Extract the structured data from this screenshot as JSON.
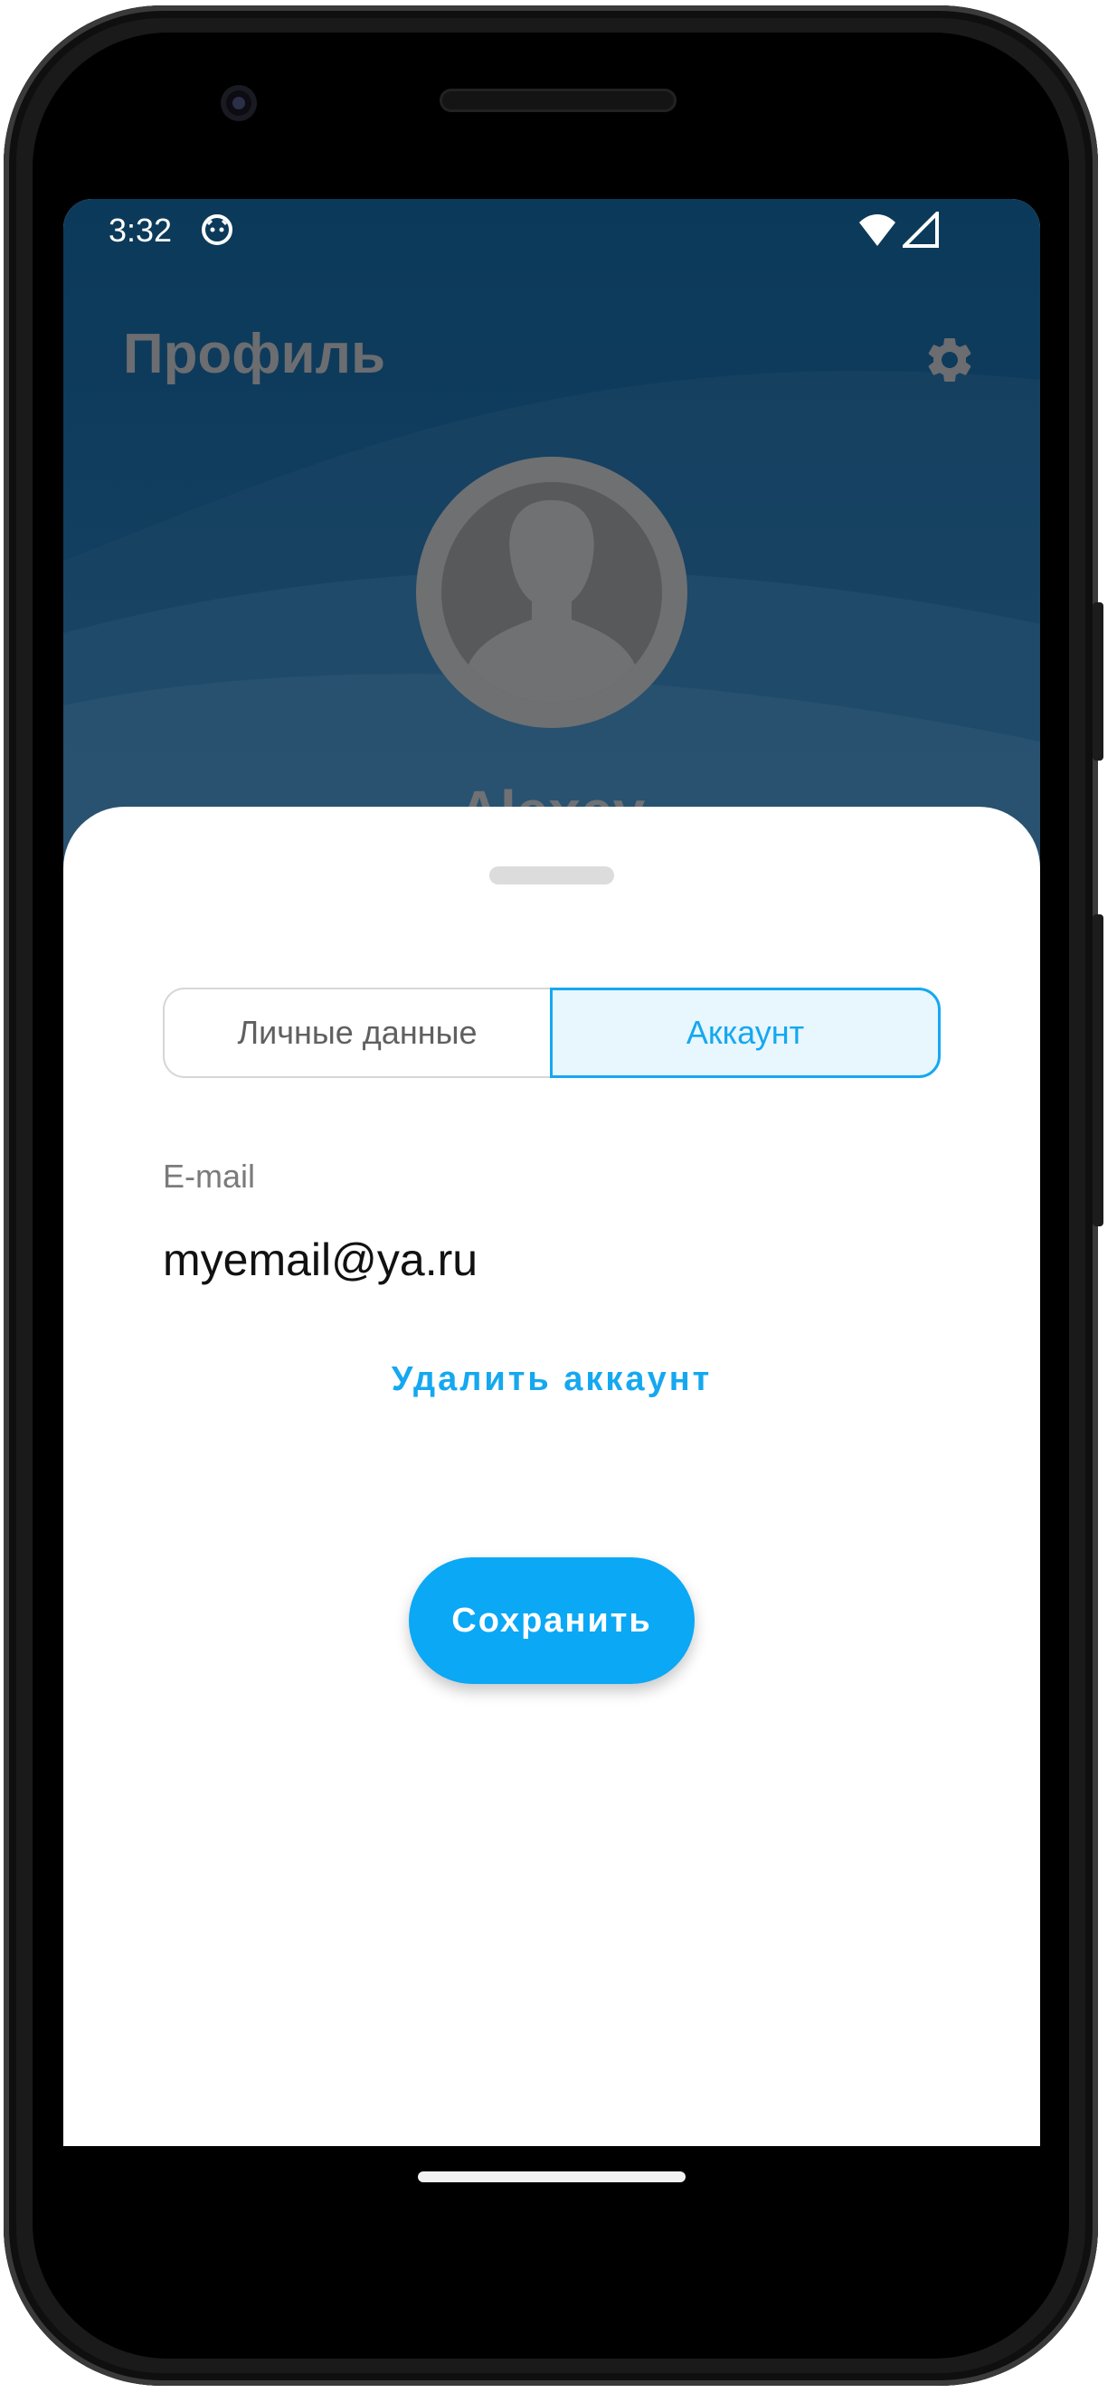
{
  "status_bar": {
    "time": "3:32",
    "app_icon": "android-debug-icon",
    "wifi_icon": "wifi-icon",
    "signal_icon": "cellular-signal-icon"
  },
  "header": {
    "title": "Профиль",
    "settings_icon": "gear-icon",
    "avatar_icon": "person-silhouette-icon",
    "user_name": "Alexey"
  },
  "sheet": {
    "tabs": [
      {
        "label": "Личные данные",
        "selected": false
      },
      {
        "label": "Аккаунт",
        "selected": true
      }
    ],
    "email_label": "E-mail",
    "email_value": "myemail@ya.ru",
    "delete_account": "Удалить аккаунт",
    "save": "Сохранить"
  },
  "colors": {
    "accent": "#15a8f0",
    "header_bg": "#0e466d",
    "sheet_bg": "#ffffff"
  }
}
